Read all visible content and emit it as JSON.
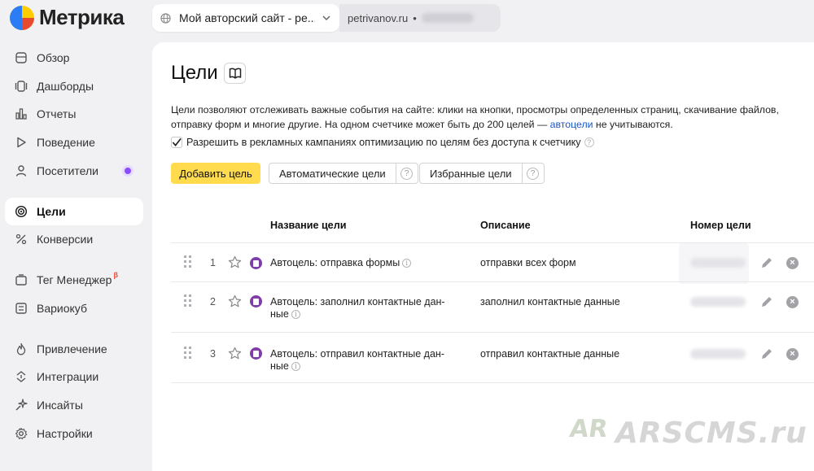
{
  "app": {
    "logo_text": "Метрика"
  },
  "site_selector": {
    "site_name": "Мой авторский сайт - ре...",
    "domain": "petrivanov.ru",
    "separator": "•"
  },
  "sidebar": {
    "items": [
      {
        "label": "Обзор",
        "icon": "home-icon"
      },
      {
        "label": "Дашборды",
        "icon": "dashboard-icon"
      },
      {
        "label": "Отчеты",
        "icon": "bar-chart-icon"
      },
      {
        "label": "Поведение",
        "icon": "play-icon"
      },
      {
        "label": "Посетители",
        "icon": "person-icon"
      },
      {
        "label": "Цели",
        "icon": "target-icon",
        "active": true
      },
      {
        "label": "Конверсии",
        "icon": "percent-icon"
      },
      {
        "label": "Тег Менеджер",
        "icon": "tag-icon",
        "badge": "β"
      },
      {
        "label": "Вариокуб",
        "icon": "cube-icon"
      },
      {
        "label": "Привлечение",
        "icon": "flame-icon"
      },
      {
        "label": "Интеграции",
        "icon": "integrations-icon"
      },
      {
        "label": "Инсайты",
        "icon": "sparkle-icon"
      },
      {
        "label": "Настройки",
        "icon": "gear-icon"
      }
    ]
  },
  "main": {
    "title": "Цели",
    "description_part1": "Цели позволяют отслеживать важные события на сайте: клики на кнопки, просмотры определенных страниц, скачивание файлов, отправку форм и многие другие. На одном счетчике может быть до 200 целей — ",
    "description_link": "автоцели",
    "description_part2": " не учитываются.",
    "checkbox_label": "Разрешить в рекламных кампаниях оптимизацию по целям без доступа к счетчику",
    "checkbox_checked": true,
    "add_button": "Добавить цель",
    "auto_goals_button": "Автоматические цели",
    "favorite_goals_button": "Избранные цели",
    "help_symbol": "?",
    "table": {
      "headers": {
        "name": "Название цели",
        "description": "Описание",
        "id": "Номер цели"
      },
      "rows": [
        {
          "num": "1",
          "name": "Автоцель: отправка формы",
          "description": "отправки всех форм"
        },
        {
          "num": "2",
          "name": "Автоцель: заполнил контактные дан-ные",
          "description": "заполнил контактные данные"
        },
        {
          "num": "3",
          "name": "Автоцель: отправил контактные дан-ные",
          "description": "отправил контактные данные"
        }
      ]
    }
  },
  "watermark": {
    "prefix": "AR",
    "text": "ARSCMS.ru"
  },
  "colors": {
    "accent_yellow": "#ffdb4d",
    "link": "#1a57c9",
    "goal_icon": "#7e3ea8",
    "badge_purple": "#8a4dff"
  }
}
